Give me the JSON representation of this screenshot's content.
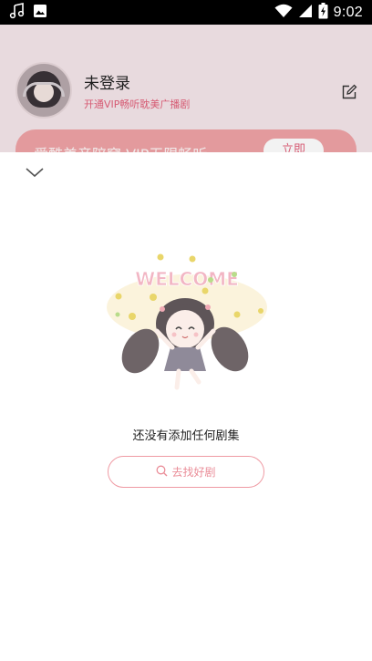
{
  "status_bar": {
    "time": "9:02",
    "left_icons": [
      "music-note-icon",
      "image-icon"
    ],
    "right_icons": [
      "wifi-icon",
      "signal-icon",
      "battery-icon"
    ]
  },
  "background_profile": {
    "name": "未登录",
    "subtitle": "开通VIP畅听耽美广播剧",
    "banner_text": "爱酷美音陪窝 VIP无限畅听",
    "banner_button": "立即"
  },
  "sheet": {
    "collapse_icon": "chevron-down-icon",
    "illustration_text": "WELCOME",
    "empty_message": "还没有添加任何剧集",
    "find_button_label": "去找好剧",
    "find_button_icon": "search-icon"
  },
  "colors": {
    "accent": "#ea8d98",
    "accent_border": "#ef9aa3",
    "profile_sub": "#e2607a"
  }
}
